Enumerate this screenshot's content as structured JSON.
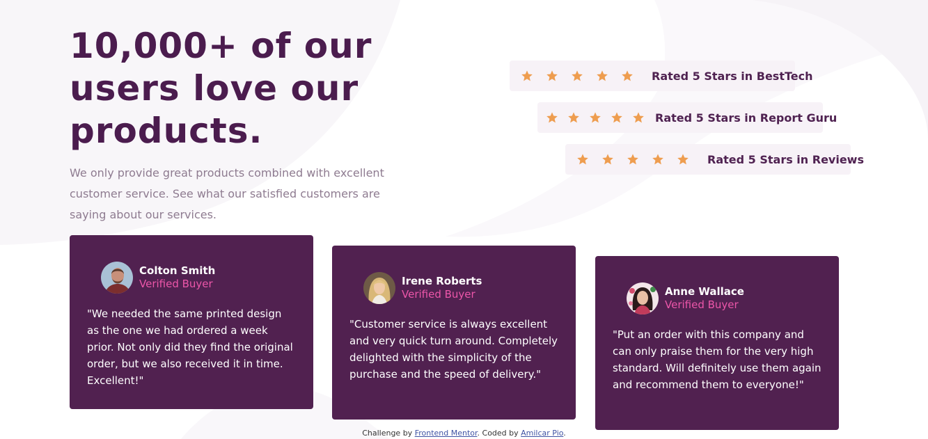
{
  "heading": "10,000+ of our users love our products.",
  "intro": "We only provide great products combined with excellent customer service. See what our satisfied customers are saying about our services.",
  "ratings": [
    {
      "label": "Rated 5 Stars in BestTech",
      "stars": 5
    },
    {
      "label": "Rated 5 Stars in Report Guru",
      "stars": 5
    },
    {
      "label": "Rated 5 Stars in Reviews",
      "stars": 5
    }
  ],
  "testimonials": [
    {
      "name": "Colton Smith",
      "badge": "Verified Buyer",
      "quote": "\"We needed the same printed design as the one we had ordered a week prior. Not only did they find the original order, but we also received it in time. Excellent!\""
    },
    {
      "name": "Irene Roberts",
      "badge": "Verified Buyer",
      "quote": "\"Customer service is always excellent and very quick turn around. Completely delighted with the simplicity of the purchase and the speed of delivery.\""
    },
    {
      "name": "Anne Wallace",
      "badge": "Verified Buyer",
      "quote": "\"Put an order with this company and can only praise them for the very high standard. Will definitely use them again and recommend them to everyone!\""
    }
  ],
  "attribution": {
    "prefix": "Challenge by",
    "link1": "Frontend Mentor",
    "middle": ". Coded by",
    "link2": "Amilcar Pio",
    "suffix": "."
  },
  "colors": {
    "heading": "#4b1c4e",
    "card": "#512150",
    "accent_pink": "#ec56a9",
    "star": "#ee9d4f",
    "rating_bg": "#f7f2f7"
  }
}
